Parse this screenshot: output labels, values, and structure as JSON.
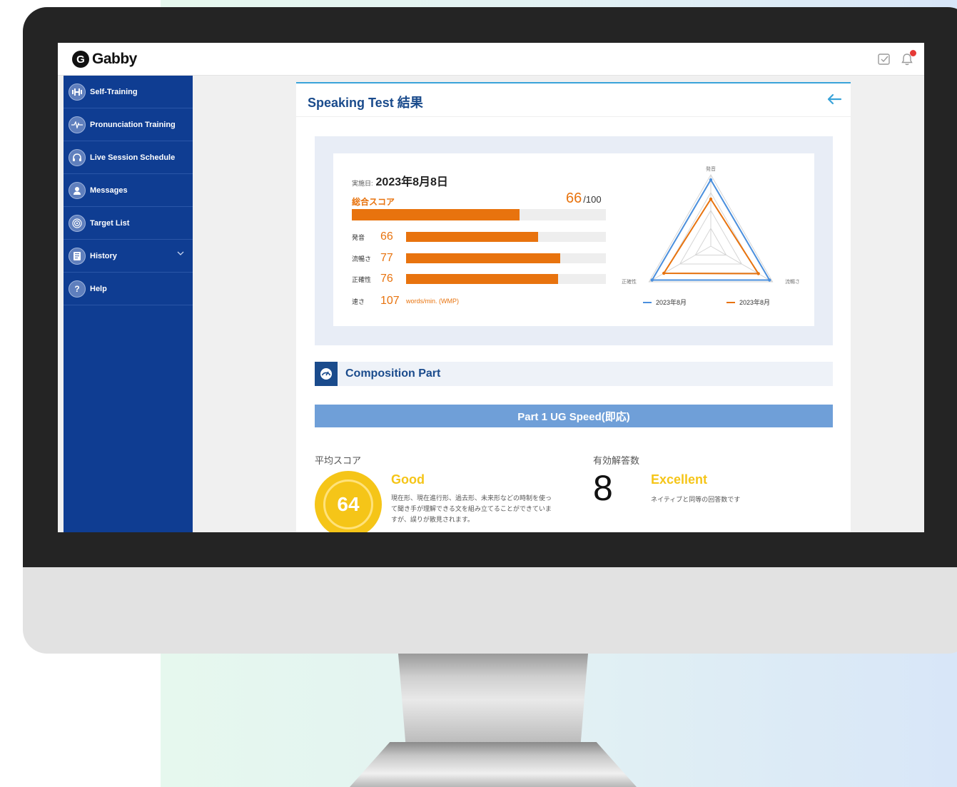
{
  "app": {
    "name": "Gabby"
  },
  "sidebar": {
    "items": [
      {
        "label": "Self-Training",
        "icon": "dumbbell-icon"
      },
      {
        "label": "Pronunciation Training",
        "icon": "waveform-icon"
      },
      {
        "label": "Live Session Schedule",
        "icon": "headset-icon"
      },
      {
        "label": "Messages",
        "icon": "chat-icon"
      },
      {
        "label": "Target List",
        "icon": "target-icon"
      },
      {
        "label": "History",
        "icon": "book-icon",
        "expandable": true
      },
      {
        "label": "Help",
        "icon": "help-icon",
        "glyph": "?"
      }
    ]
  },
  "page": {
    "title": "Speaking Test 結果"
  },
  "score": {
    "date_label": "実施日:",
    "date_value": "2023年8月8日",
    "total_label": "総合スコア",
    "total_value": "66",
    "total_max": "/100",
    "total_fraction": 0.66,
    "metrics": [
      {
        "label": "発音",
        "value": "66",
        "fraction": 0.66
      },
      {
        "label": "流暢さ",
        "value": "77",
        "fraction": 0.77
      },
      {
        "label": "正確性",
        "value": "76",
        "fraction": 0.76
      }
    ],
    "speed_label": "速さ",
    "speed_value": "107",
    "speed_unit": "words/min. (WMP)"
  },
  "radar": {
    "axes": [
      "発音",
      "流暢さ",
      "正確性"
    ],
    "series": [
      {
        "name": "2023年8月",
        "color": "#4a8fdd",
        "values": [
          0.93,
          0.95,
          0.95
        ]
      },
      {
        "name": "2023年8月",
        "color": "#e8730e",
        "values": [
          0.66,
          0.77,
          0.76
        ]
      }
    ]
  },
  "composition": {
    "title": "Composition Part",
    "part_title": "Part 1 UG Speed(即応)",
    "avg_label": "平均スコア",
    "avg_score": "64",
    "avg_grade": "Good",
    "avg_desc": "現在形、現在進行形、過去形、未来形などの時制を使って聞き手が理解できる文を組み立てることができていますが、誤りが散見されます。",
    "valid_label": "有効解答数",
    "valid_count": "8",
    "valid_grade": "Excellent",
    "valid_desc": "ネイティブと同等の回答数です"
  },
  "colors": {
    "sidebar": "#0f3d92",
    "accent_orange": "#e8730e",
    "accent_blue": "#1a4b8c",
    "part_bar": "#6f9fd8",
    "good_yellow": "#f5c518"
  }
}
